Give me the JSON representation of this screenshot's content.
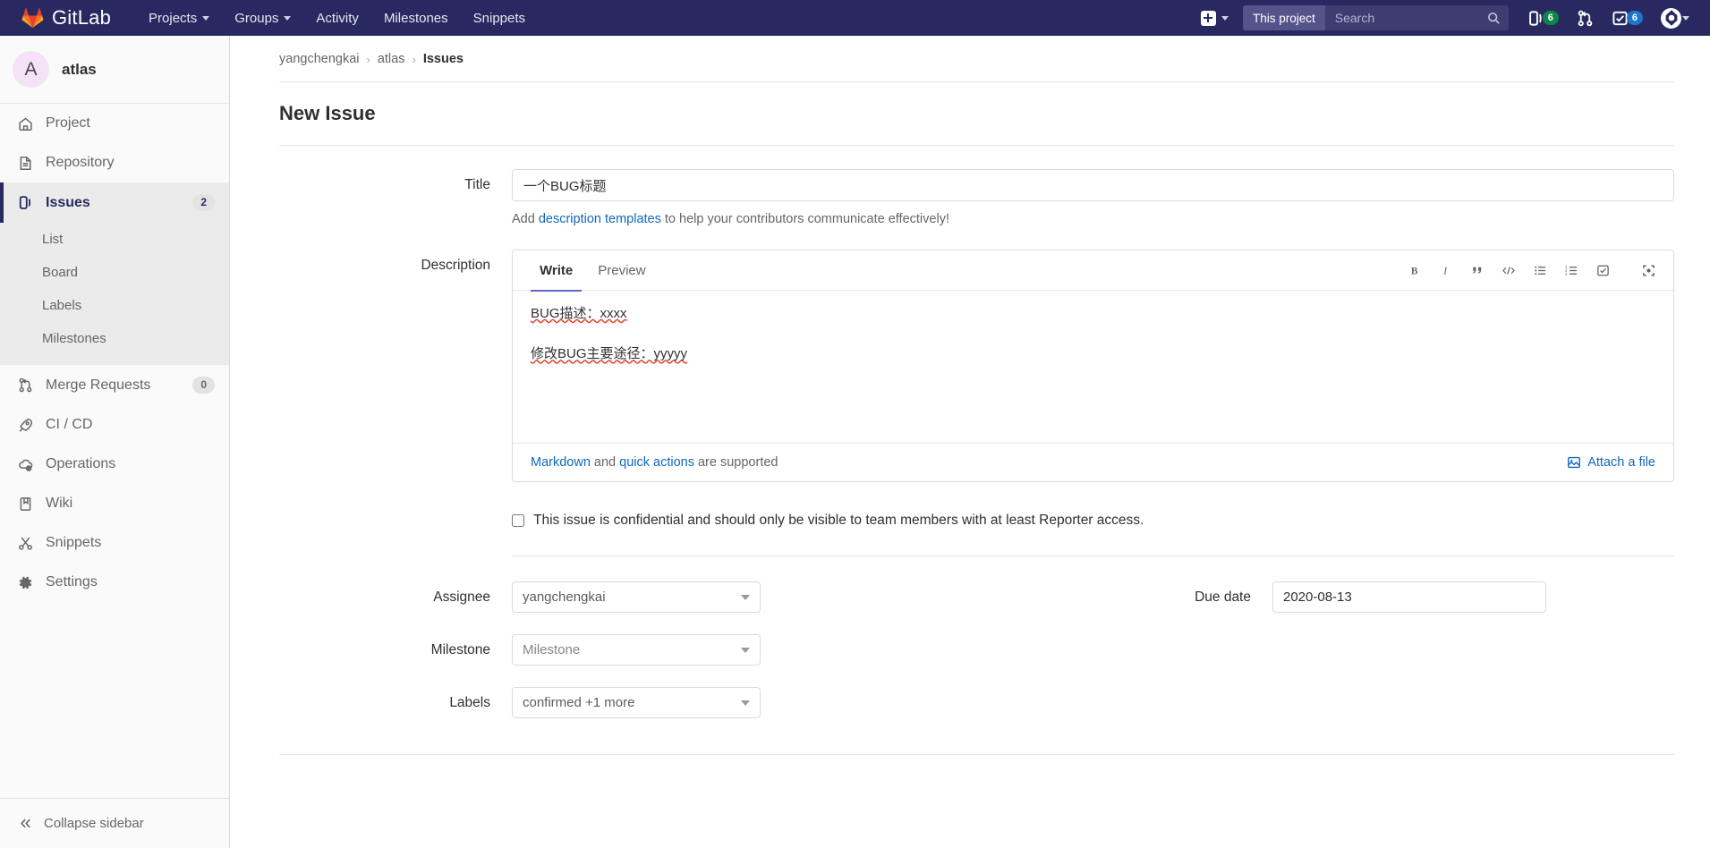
{
  "navbar": {
    "brand": "GitLab",
    "links": [
      {
        "label": "Projects",
        "has_caret": true
      },
      {
        "label": "Groups",
        "has_caret": true
      },
      {
        "label": "Activity",
        "has_caret": false
      },
      {
        "label": "Milestones",
        "has_caret": false
      },
      {
        "label": "Snippets",
        "has_caret": false
      }
    ],
    "search": {
      "scope": "This project",
      "placeholder": "Search",
      "value": ""
    },
    "issues_count": "6",
    "todos_count": "6",
    "colors": {
      "navbar_bg": "#292961",
      "green_badge": "#108548",
      "blue_badge": "#1f75cb"
    }
  },
  "sidebar": {
    "project_initial": "A",
    "project_name": "atlas",
    "items": [
      {
        "label": "Project",
        "icon": "home-icon",
        "badge": null
      },
      {
        "label": "Repository",
        "icon": "document-icon",
        "badge": null
      },
      {
        "label": "Issues",
        "icon": "issues-icon",
        "badge": "2",
        "active": true,
        "children": [
          "List",
          "Board",
          "Labels",
          "Milestones"
        ]
      },
      {
        "label": "Merge Requests",
        "icon": "merge-request-icon",
        "badge": "0"
      },
      {
        "label": "CI / CD",
        "icon": "rocket-icon",
        "badge": null
      },
      {
        "label": "Operations",
        "icon": "cloud-gear-icon",
        "badge": null
      },
      {
        "label": "Wiki",
        "icon": "book-icon",
        "badge": null
      },
      {
        "label": "Snippets",
        "icon": "scissors-icon",
        "badge": null
      },
      {
        "label": "Settings",
        "icon": "gear-icon",
        "badge": null
      }
    ],
    "collapse_label": "Collapse sidebar"
  },
  "breadcrumb": {
    "owner": "yangchengkai",
    "project": "atlas",
    "section": "Issues"
  },
  "page_title": "New Issue",
  "form": {
    "title_label": "Title",
    "title_value": "一个BUG标题",
    "title_placeholder": "Title",
    "template_helper": {
      "prefix": "Add ",
      "link": "description templates",
      "suffix": " to help your contributors communicate effectively!"
    },
    "description_label": "Description",
    "editor": {
      "tab_write": "Write",
      "tab_preview": "Preview",
      "tools": [
        {
          "name": "bold-icon",
          "glyph": "B"
        },
        {
          "name": "italic-icon",
          "glyph": "I"
        },
        {
          "name": "quote-icon",
          "glyph": "❞"
        },
        {
          "name": "code-icon",
          "glyph": "</>"
        },
        {
          "name": "bullet-list-icon",
          "glyph": "☰"
        },
        {
          "name": "numbered-list-icon",
          "glyph": "≡"
        },
        {
          "name": "task-list-icon",
          "glyph": "☑"
        },
        {
          "name": "fullscreen-icon",
          "glyph": "⛶"
        }
      ],
      "body_lines": [
        "BUG描述：xxxx",
        "修改BUG主要途径：yyyyy"
      ],
      "footer": {
        "markdown_link": "Markdown",
        "and_text": " and ",
        "quick_actions_link": "quick actions",
        "suffix": " are supported",
        "attach_label": "Attach a file"
      }
    },
    "confidential_label": "This issue is confidential and should only be visible to team members with at least Reporter access.",
    "confidential_checked": false,
    "assignee_label": "Assignee",
    "assignee_value": "yangchengkai",
    "milestone_label": "Milestone",
    "milestone_value": "Milestone",
    "labels_label": "Labels",
    "labels_value": "confirmed +1 more",
    "due_date_label": "Due date",
    "due_date_value": "2020-08-13"
  }
}
